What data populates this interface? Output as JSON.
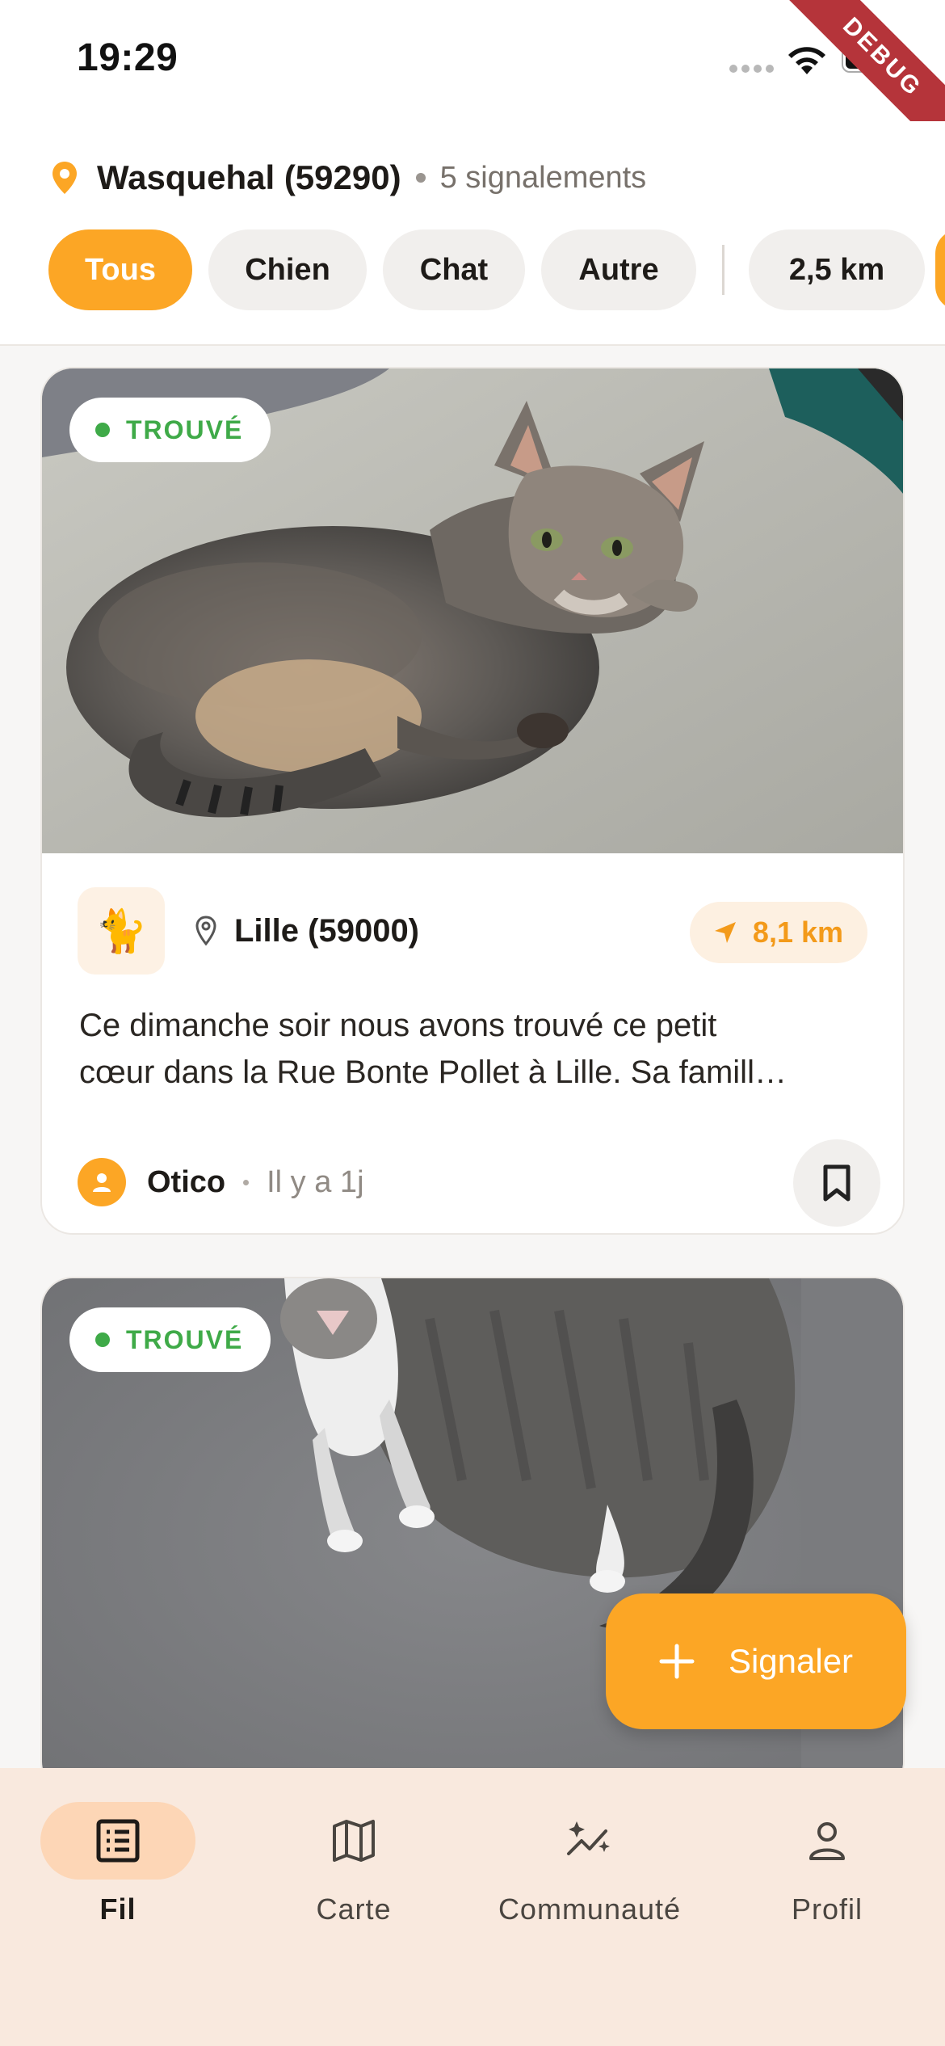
{
  "status_bar": {
    "time": "19:29",
    "debug_label": "DEBUG"
  },
  "header": {
    "location": "Wasquehal (59290)",
    "report_count": "5 signalements",
    "filters": [
      "Tous",
      "Chien",
      "Chat",
      "Autre"
    ],
    "active_filter": "Tous",
    "radius": "2,5 km"
  },
  "feed": {
    "cards": [
      {
        "status": "TROUVÉ",
        "species_icon": "cat-icon",
        "city": "Lille (59000)",
        "distance": "8,1 km",
        "description_line1": "Ce dimanche soir nous avons trouvé ce petit",
        "description_line2": "cœur dans la Rue Bonte Pollet à Lille. Sa famill…",
        "author": "Otico",
        "time_ago": "Il y a 1j"
      },
      {
        "status": "TROUVÉ"
      }
    ]
  },
  "fab": {
    "label": "Signaler"
  },
  "bottom_nav": {
    "items": [
      {
        "label": "Fil",
        "icon": "list-icon"
      },
      {
        "label": "Carte",
        "icon": "map-icon"
      },
      {
        "label": "Communauté",
        "icon": "sparkle-chart-icon"
      },
      {
        "label": "Profil",
        "icon": "person-icon"
      }
    ],
    "active": "Fil"
  },
  "colors": {
    "accent": "#fca625",
    "found_green": "#3faa48",
    "nav_background": "#f9e9de",
    "nav_active": "#fdd6b6"
  }
}
